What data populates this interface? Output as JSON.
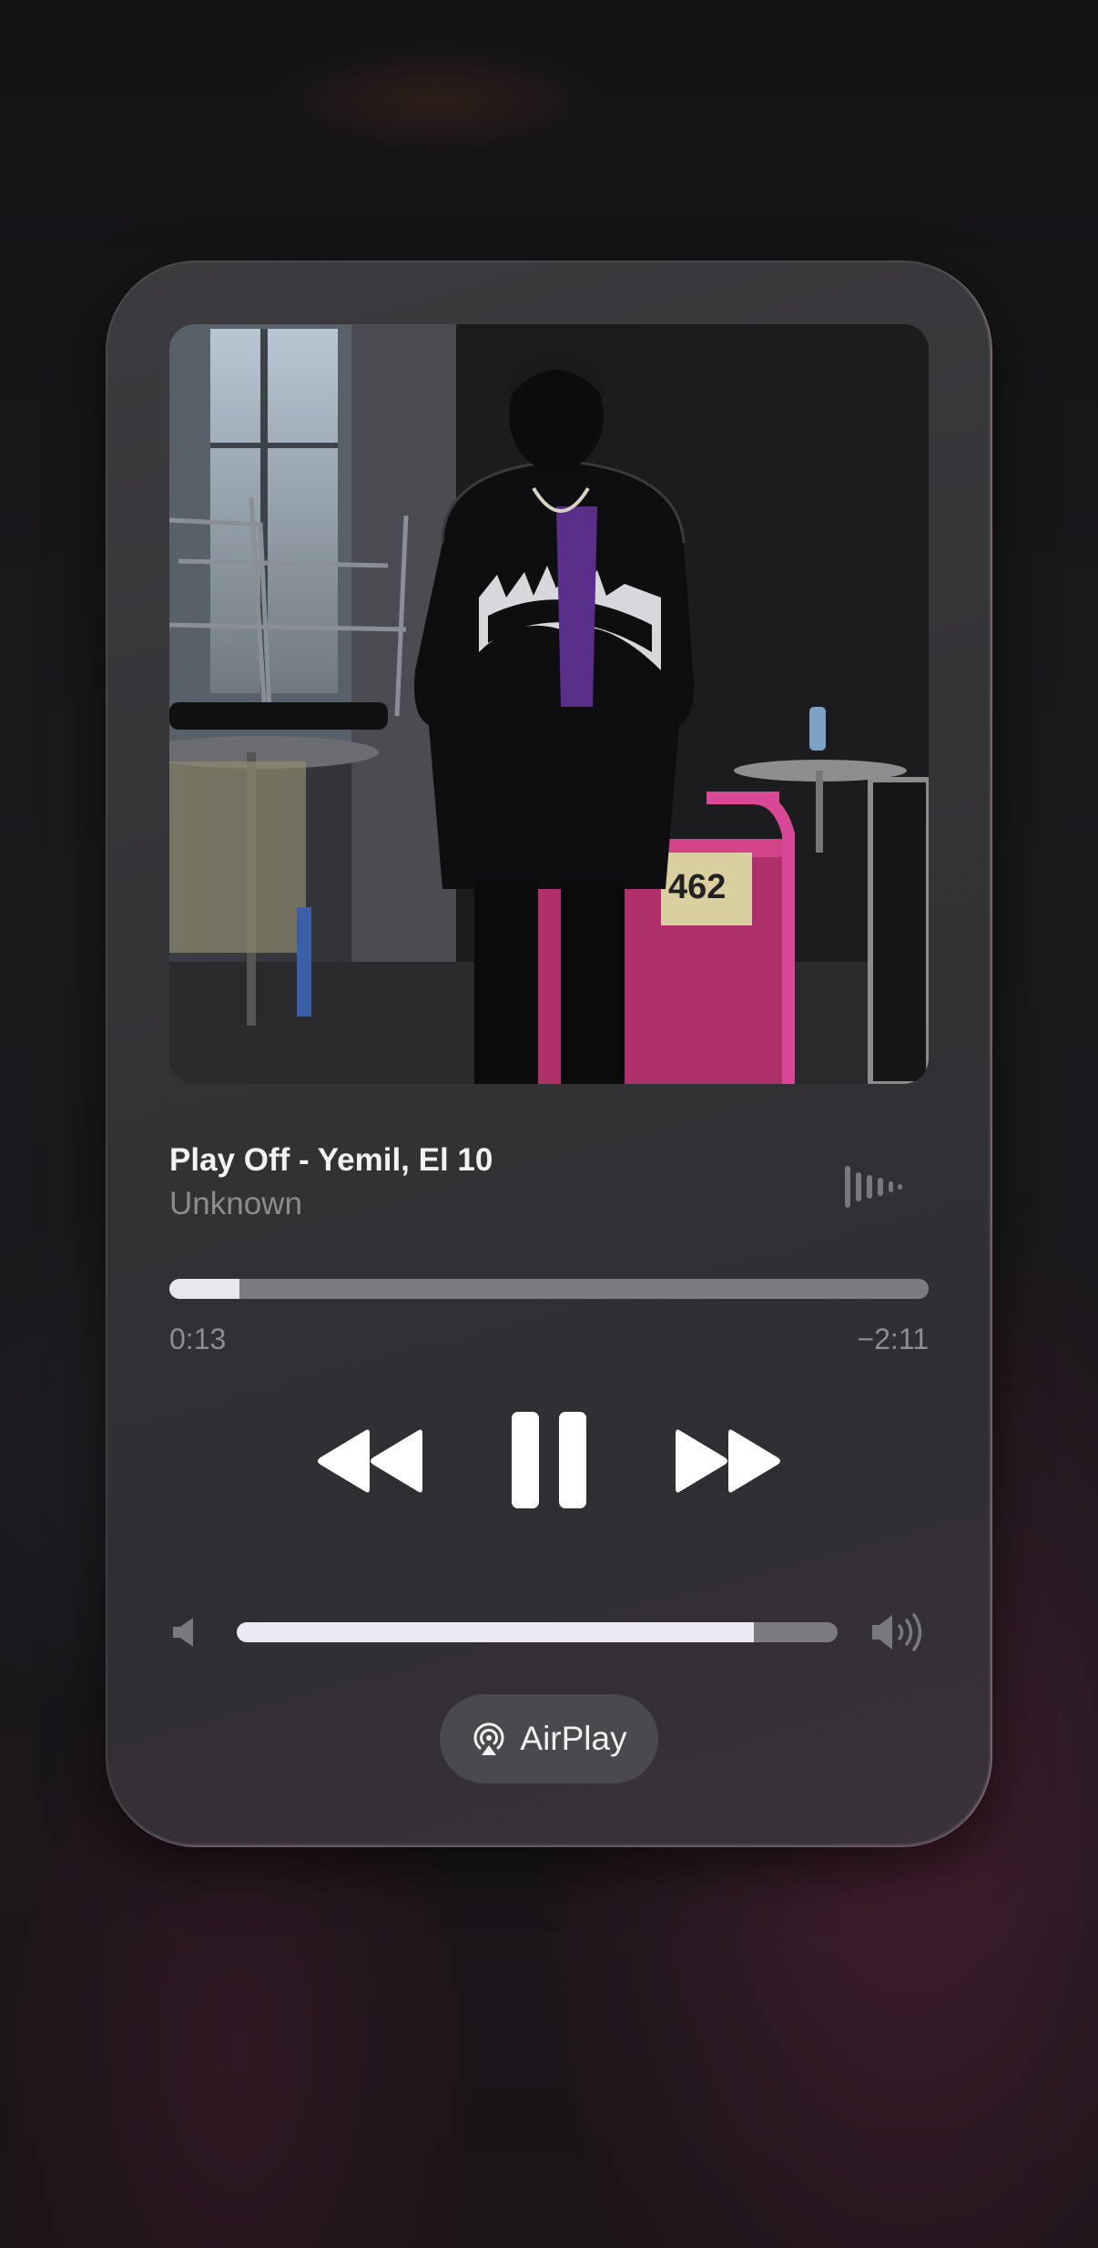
{
  "now_playing": {
    "title": "Play Off - Yemil, El 10",
    "artist": "Unknown",
    "elapsed": "0:13",
    "remaining": "−2:11",
    "progress_fraction": 0.092
  },
  "controls": {
    "rewind_icon": "backward-icon",
    "pause_icon": "pause-icon",
    "forward_icon": "forward-icon",
    "waveform_icon": "waveform-icon"
  },
  "volume": {
    "level_fraction": 0.86,
    "low_icon": "speaker-low-icon",
    "high_icon": "speaker-high-icon"
  },
  "airplay": {
    "label": "AirPlay",
    "icon": "airplay-icon"
  },
  "colors": {
    "card": "#333235",
    "accent_fill": "#e9e7ee",
    "track": "#7d7a80",
    "secondary_text": "#8c8b90"
  }
}
